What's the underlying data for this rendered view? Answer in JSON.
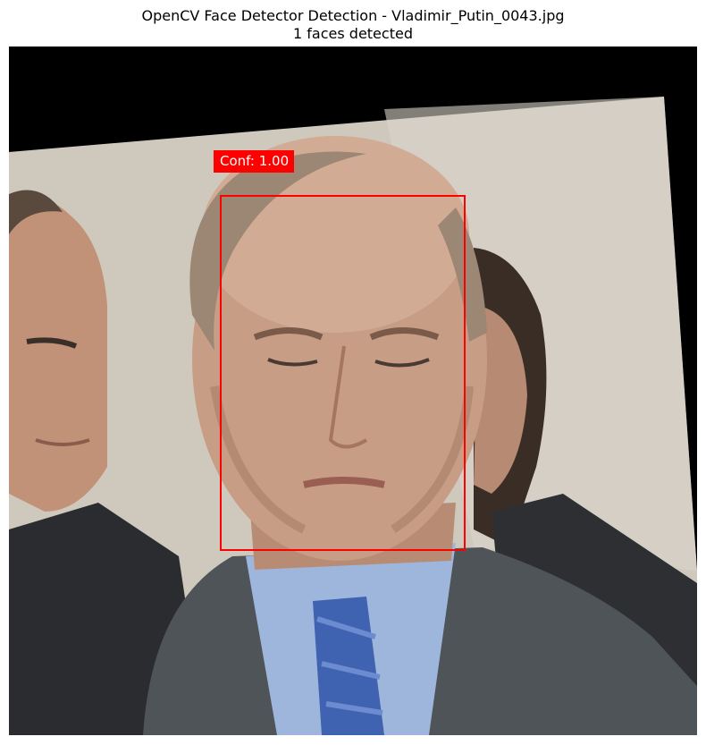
{
  "figure": {
    "title_line1": "OpenCV Face Detector Detection - Vladimir_Putin_0043.jpg",
    "title_line2": "1 faces detected"
  },
  "detections": [
    {
      "label": "Conf: 1.00",
      "box_color": "#ff0000"
    }
  ],
  "colors": {
    "background": "#ffffff",
    "letterbox": "#000000",
    "wall": "#cfc8bd",
    "suit": "#4e5458",
    "shirt": "#9fb6dc",
    "tie": "#3f63b0",
    "skin": "#c79d86"
  }
}
